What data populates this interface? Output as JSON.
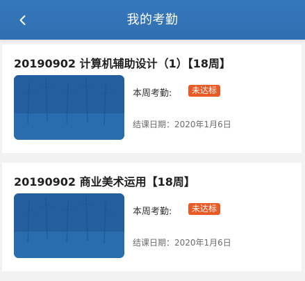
{
  "header": {
    "title": "我的考勤"
  },
  "courses": [
    {
      "title": "20190902 计算机辅助设计（1）【18周】",
      "weekly_label": "本周考勤:",
      "status_badge": "未达标",
      "end_date": "结课日期：2020年1月6日"
    },
    {
      "title": "20190902 商业美术运用【18周】",
      "weekly_label": "本周考勤:",
      "status_badge": "未达标",
      "end_date": "结课日期：2020年1月6日"
    }
  ],
  "colors": {
    "header_bg": "#2f6eb0",
    "badge_bg": "#ea5a24",
    "page_bg": "#f2f2f2"
  }
}
